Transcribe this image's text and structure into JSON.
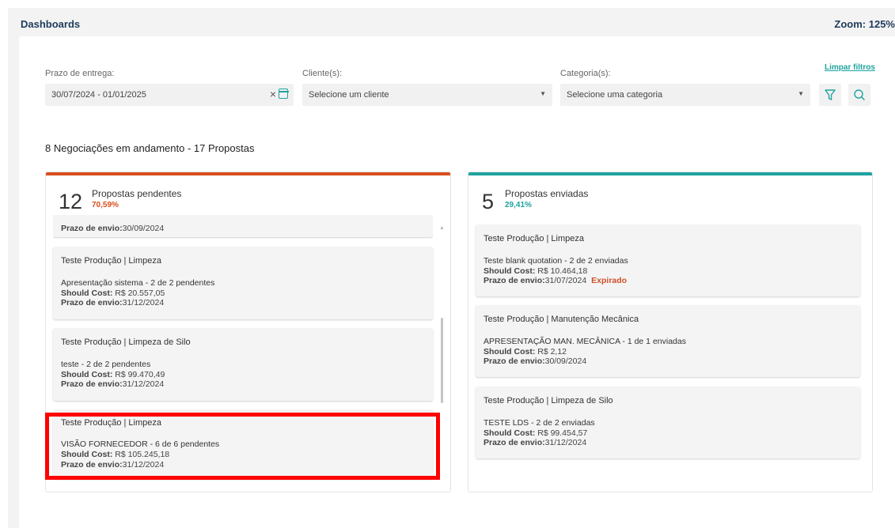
{
  "header": {
    "title": "Dashboards",
    "zoom": "Zoom: 125%"
  },
  "filters": {
    "delivery_label": "Prazo de entrega:",
    "delivery_value": "30/07/2024 - 01/01/2025",
    "client_label": "Cliente(s):",
    "client_placeholder": "Selecione um cliente",
    "category_label": "Categoria(s):",
    "category_placeholder": "Selecione uma categoria",
    "clear_label": "Limpar filtros"
  },
  "summary": "8 Negociações em andamento - 17 Propostas",
  "colors": {
    "pending": "#d94f1e",
    "sent": "#1fa3a0"
  },
  "pending": {
    "count": "12",
    "title": "Propostas pendentes",
    "percent": "70,59%",
    "partial_deadline": "30/09/2024",
    "cards": [
      {
        "title": "Teste Produção | Limpeza",
        "line": "Apresentação sistema - 2 de 2 pendentes",
        "cost": "R$ 20.557,05",
        "deadline": "31/12/2024"
      },
      {
        "title": "Teste Produção | Limpeza de Silo",
        "line": "teste - 2 de 2 pendentes",
        "cost": "R$ 99.470,49",
        "deadline": "31/12/2024"
      },
      {
        "title": "Teste Produção | Limpeza",
        "line": "VISÃO FORNECEDOR - 6 de 6 pendentes",
        "cost": "R$ 105.245,18",
        "deadline": "31/12/2024"
      }
    ]
  },
  "sent": {
    "count": "5",
    "title": "Propostas enviadas",
    "percent": "29,41%",
    "cards": [
      {
        "title": "Teste Produção | Limpeza",
        "line": "Teste blank quotation - 2 de 2 enviadas",
        "cost": "R$ 10.464,18",
        "deadline": "31/07/2024",
        "status": "Expirado"
      },
      {
        "title": "Teste Produção | Manutenção Mecânica",
        "line": "APRESENTAÇÃO MAN. MECÂNICA - 1 de 1 enviadas",
        "cost": "R$ 2,12",
        "deadline": "30/09/2024"
      },
      {
        "title": "Teste Produção | Limpeza de Silo",
        "line": "TESTE LDS - 2 de 2 enviadas",
        "cost": "R$ 99.454,57",
        "deadline": "31/12/2024"
      }
    ]
  },
  "labels": {
    "should_cost": "Should Cost:",
    "deadline": "Prazo de envio:"
  }
}
